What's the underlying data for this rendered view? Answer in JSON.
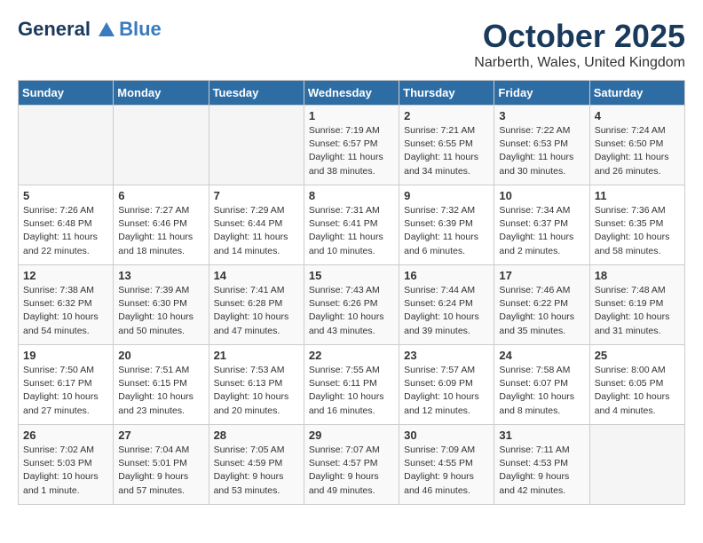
{
  "header": {
    "logo_line1": "General",
    "logo_line2": "Blue",
    "month_title": "October 2025",
    "location": "Narberth, Wales, United Kingdom"
  },
  "weekdays": [
    "Sunday",
    "Monday",
    "Tuesday",
    "Wednesday",
    "Thursday",
    "Friday",
    "Saturday"
  ],
  "weeks": [
    [
      {
        "day": "",
        "info": ""
      },
      {
        "day": "",
        "info": ""
      },
      {
        "day": "",
        "info": ""
      },
      {
        "day": "1",
        "info": "Sunrise: 7:19 AM\nSunset: 6:57 PM\nDaylight: 11 hours\nand 38 minutes."
      },
      {
        "day": "2",
        "info": "Sunrise: 7:21 AM\nSunset: 6:55 PM\nDaylight: 11 hours\nand 34 minutes."
      },
      {
        "day": "3",
        "info": "Sunrise: 7:22 AM\nSunset: 6:53 PM\nDaylight: 11 hours\nand 30 minutes."
      },
      {
        "day": "4",
        "info": "Sunrise: 7:24 AM\nSunset: 6:50 PM\nDaylight: 11 hours\nand 26 minutes."
      }
    ],
    [
      {
        "day": "5",
        "info": "Sunrise: 7:26 AM\nSunset: 6:48 PM\nDaylight: 11 hours\nand 22 minutes."
      },
      {
        "day": "6",
        "info": "Sunrise: 7:27 AM\nSunset: 6:46 PM\nDaylight: 11 hours\nand 18 minutes."
      },
      {
        "day": "7",
        "info": "Sunrise: 7:29 AM\nSunset: 6:44 PM\nDaylight: 11 hours\nand 14 minutes."
      },
      {
        "day": "8",
        "info": "Sunrise: 7:31 AM\nSunset: 6:41 PM\nDaylight: 11 hours\nand 10 minutes."
      },
      {
        "day": "9",
        "info": "Sunrise: 7:32 AM\nSunset: 6:39 PM\nDaylight: 11 hours\nand 6 minutes."
      },
      {
        "day": "10",
        "info": "Sunrise: 7:34 AM\nSunset: 6:37 PM\nDaylight: 11 hours\nand 2 minutes."
      },
      {
        "day": "11",
        "info": "Sunrise: 7:36 AM\nSunset: 6:35 PM\nDaylight: 10 hours\nand 58 minutes."
      }
    ],
    [
      {
        "day": "12",
        "info": "Sunrise: 7:38 AM\nSunset: 6:32 PM\nDaylight: 10 hours\nand 54 minutes."
      },
      {
        "day": "13",
        "info": "Sunrise: 7:39 AM\nSunset: 6:30 PM\nDaylight: 10 hours\nand 50 minutes."
      },
      {
        "day": "14",
        "info": "Sunrise: 7:41 AM\nSunset: 6:28 PM\nDaylight: 10 hours\nand 47 minutes."
      },
      {
        "day": "15",
        "info": "Sunrise: 7:43 AM\nSunset: 6:26 PM\nDaylight: 10 hours\nand 43 minutes."
      },
      {
        "day": "16",
        "info": "Sunrise: 7:44 AM\nSunset: 6:24 PM\nDaylight: 10 hours\nand 39 minutes."
      },
      {
        "day": "17",
        "info": "Sunrise: 7:46 AM\nSunset: 6:22 PM\nDaylight: 10 hours\nand 35 minutes."
      },
      {
        "day": "18",
        "info": "Sunrise: 7:48 AM\nSunset: 6:19 PM\nDaylight: 10 hours\nand 31 minutes."
      }
    ],
    [
      {
        "day": "19",
        "info": "Sunrise: 7:50 AM\nSunset: 6:17 PM\nDaylight: 10 hours\nand 27 minutes."
      },
      {
        "day": "20",
        "info": "Sunrise: 7:51 AM\nSunset: 6:15 PM\nDaylight: 10 hours\nand 23 minutes."
      },
      {
        "day": "21",
        "info": "Sunrise: 7:53 AM\nSunset: 6:13 PM\nDaylight: 10 hours\nand 20 minutes."
      },
      {
        "day": "22",
        "info": "Sunrise: 7:55 AM\nSunset: 6:11 PM\nDaylight: 10 hours\nand 16 minutes."
      },
      {
        "day": "23",
        "info": "Sunrise: 7:57 AM\nSunset: 6:09 PM\nDaylight: 10 hours\nand 12 minutes."
      },
      {
        "day": "24",
        "info": "Sunrise: 7:58 AM\nSunset: 6:07 PM\nDaylight: 10 hours\nand 8 minutes."
      },
      {
        "day": "25",
        "info": "Sunrise: 8:00 AM\nSunset: 6:05 PM\nDaylight: 10 hours\nand 4 minutes."
      }
    ],
    [
      {
        "day": "26",
        "info": "Sunrise: 7:02 AM\nSunset: 5:03 PM\nDaylight: 10 hours\nand 1 minute."
      },
      {
        "day": "27",
        "info": "Sunrise: 7:04 AM\nSunset: 5:01 PM\nDaylight: 9 hours\nand 57 minutes."
      },
      {
        "day": "28",
        "info": "Sunrise: 7:05 AM\nSunset: 4:59 PM\nDaylight: 9 hours\nand 53 minutes."
      },
      {
        "day": "29",
        "info": "Sunrise: 7:07 AM\nSunset: 4:57 PM\nDaylight: 9 hours\nand 49 minutes."
      },
      {
        "day": "30",
        "info": "Sunrise: 7:09 AM\nSunset: 4:55 PM\nDaylight: 9 hours\nand 46 minutes."
      },
      {
        "day": "31",
        "info": "Sunrise: 7:11 AM\nSunset: 4:53 PM\nDaylight: 9 hours\nand 42 minutes."
      },
      {
        "day": "",
        "info": ""
      }
    ]
  ]
}
